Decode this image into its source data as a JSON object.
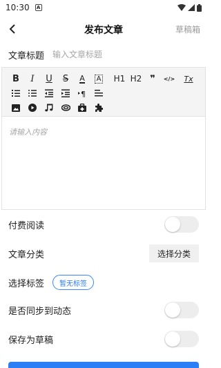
{
  "status_bar": {
    "time": "10:30",
    "notification_icon": "A"
  },
  "header": {
    "title": "发布文章",
    "drafts_label": "草稿箱",
    "back_icon": "chevron-left-icon"
  },
  "article": {
    "title_label": "文章标题",
    "title_placeholder": "输入文章标题",
    "content_placeholder": "请输入内容"
  },
  "toolbar": {
    "row1": [
      {
        "name": "bold-icon",
        "glyph": "B"
      },
      {
        "name": "italic-icon",
        "glyph": "I"
      },
      {
        "name": "underline-icon",
        "glyph": "U"
      },
      {
        "name": "strikethrough-icon",
        "glyph": "S"
      },
      {
        "name": "font-color-icon",
        "glyph": "A"
      },
      {
        "name": "background-color-icon",
        "glyph": "A"
      },
      {
        "name": "heading-1-icon",
        "glyph": "H1"
      },
      {
        "name": "heading-2-icon",
        "glyph": "H2"
      },
      {
        "name": "quote-icon",
        "glyph": "❞"
      },
      {
        "name": "code-icon",
        "glyph": "</>"
      },
      {
        "name": "clear-format-icon",
        "glyph": "Tx"
      }
    ],
    "row2": [
      {
        "name": "ordered-list-icon"
      },
      {
        "name": "bullet-list-icon"
      },
      {
        "name": "outdent-icon"
      },
      {
        "name": "indent-icon"
      },
      {
        "name": "paragraph-direction-icon"
      },
      {
        "name": "align-icon"
      }
    ],
    "row3": [
      {
        "name": "image-icon"
      },
      {
        "name": "video-icon"
      },
      {
        "name": "music-icon"
      },
      {
        "name": "attachment-icon"
      },
      {
        "name": "paid-content-icon"
      },
      {
        "name": "plugin-icon"
      }
    ]
  },
  "settings": {
    "paid_reading_label": "付费阅读",
    "paid_reading_on": false,
    "category_label": "文章分类",
    "category_button": "选择分类",
    "tags_label": "选择标签",
    "tags_chip": "暂无标签",
    "sync_label": "是否同步到动态",
    "sync_on": false,
    "save_draft_label": "保存为草稿",
    "save_draft_on": false
  },
  "colors": {
    "accent": "#2b7ff6",
    "toolbar_bg": "#f4f4f5",
    "toggle_off": "#ededed"
  }
}
